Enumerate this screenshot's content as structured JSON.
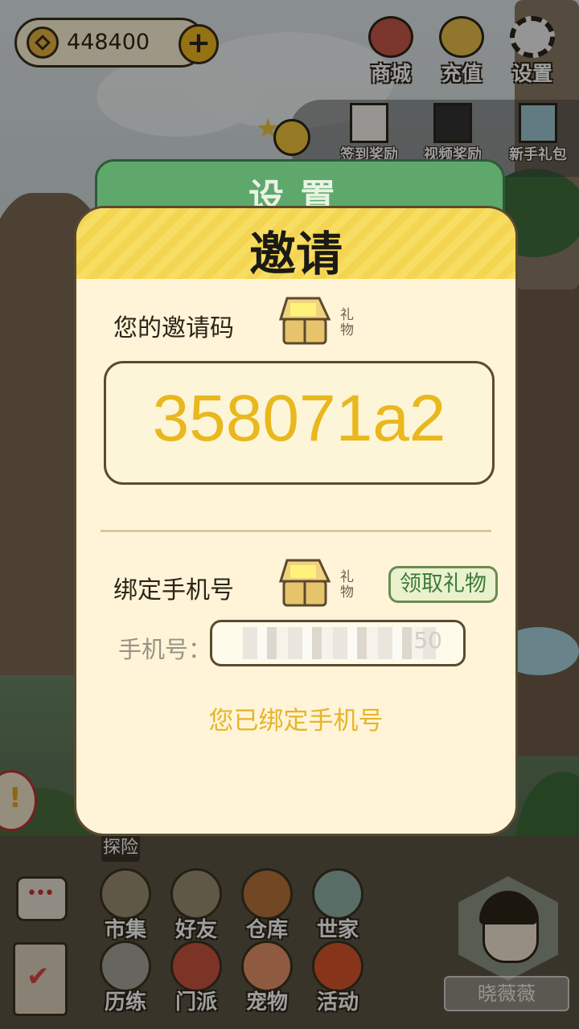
{
  "hud": {
    "coins": "448400",
    "top_buttons": [
      {
        "label": "商城",
        "icon": "gift-bag-icon"
      },
      {
        "label": "充值",
        "icon": "gold-ingot-icon"
      },
      {
        "label": "设置",
        "icon": "gear-icon"
      }
    ],
    "reward_buttons": [
      {
        "label": "签到奖励",
        "icon": "calendar-icon"
      },
      {
        "label": "视频奖励",
        "icon": "clapperboard-icon"
      },
      {
        "label": "新手礼包",
        "icon": "treasure-chest-icon"
      }
    ]
  },
  "background_panel": {
    "title": "设置"
  },
  "dialog": {
    "title": "邀请",
    "invite_code_label": "您的邀请码",
    "gift_tag": "礼物",
    "invite_code": "358071a2",
    "bind_phone_label": "绑定手机号",
    "claim_button": "领取礼物",
    "phone_label": "手机号：",
    "phone_value_visible": "50",
    "bound_message": "您已绑定手机号"
  },
  "side": {
    "exploration_tag": "探险"
  },
  "bottom_menu": {
    "row1": [
      {
        "label": "市集",
        "icon": "market-icon"
      },
      {
        "label": "好友",
        "icon": "handshake-icon"
      },
      {
        "label": "仓库",
        "icon": "chest-icon"
      },
      {
        "label": "世家",
        "icon": "armor-icon"
      }
    ],
    "row2": [
      {
        "label": "历练",
        "icon": "crossed-swords-icon"
      },
      {
        "label": "门派",
        "icon": "banner-icon"
      },
      {
        "label": "宠物",
        "icon": "paw-icon"
      },
      {
        "label": "活动",
        "icon": "lantern-icon"
      }
    ]
  },
  "player": {
    "nickname": "晓薇薇"
  },
  "colors": {
    "code_yellow": "#e9b81e",
    "dialog_bg": "#fff4d8",
    "header_yellow": "#f7dd62",
    "claim_green": "#3f7a3a"
  }
}
